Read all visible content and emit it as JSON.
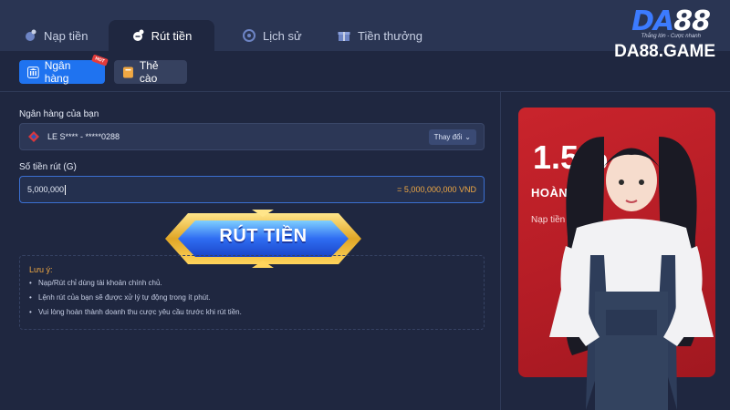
{
  "tabs": [
    {
      "label": "Nạp tiền",
      "icon": "coin-plus-icon"
    },
    {
      "label": "Rút tiền",
      "icon": "coin-minus-icon",
      "active": true
    },
    {
      "label": "Lịch sử",
      "icon": "clock-icon"
    },
    {
      "label": "Tiền thưởng",
      "icon": "gift-icon"
    }
  ],
  "logo": {
    "mark_da": "DA",
    "mark_num": "88",
    "slogan": "Thắng lớn - Cược nhanh",
    "site": "DA88.GAME"
  },
  "subtabs": [
    {
      "label": "Ngân hàng",
      "badge": "HOT",
      "active": true
    },
    {
      "label": "Thẻ cào"
    }
  ],
  "form": {
    "bank_label": "Ngân hàng của bạn",
    "bank_value": "LE S**** - *****0288",
    "change_label": "Thay đổi",
    "amount_label": "Số tiền rút (G)",
    "amount_value": "5,000,000",
    "amount_converted": "= 5,000,000,000 VND",
    "submit_label": "RÚT TIỀN"
  },
  "note": {
    "title": "Lưu ý:",
    "items": [
      "Nạp/Rút chỉ dùng tài khoản chính chủ.",
      "Lệnh rút của bạn sẽ được xử lý tự động trong ít phút.",
      "Vui lòng hoàn thành doanh thu cược yêu cầu trước khi rút tiền."
    ]
  },
  "promo": {
    "percent": "1.5%",
    "title": "HOÀN TRẢ",
    "subtitle": "Nạp tiền"
  },
  "colors": {
    "accent": "#1f73f0",
    "promo_red": "#c9242c",
    "amount_orange": "#f0a843",
    "background": "#1f2740"
  }
}
